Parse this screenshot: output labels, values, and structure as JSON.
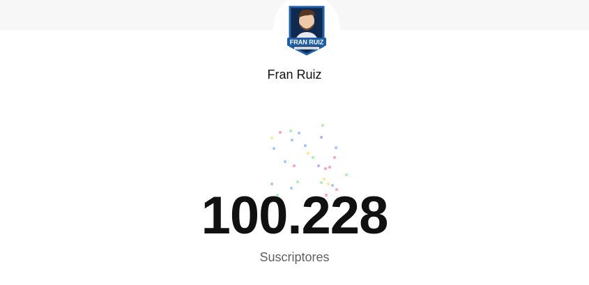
{
  "channel": {
    "name": "Fran Ruiz",
    "logo_text": "FRAN RUIZ"
  },
  "stats": {
    "subscriber_count": "100.228",
    "subscriber_label": "Suscriptores"
  },
  "colors": {
    "top_band": "#f7f7f7",
    "text_primary": "#111111",
    "text_secondary": "#606060",
    "badge_blue": "#1f5fa8",
    "badge_dark": "#0f2a4d"
  },
  "confetti_colors": [
    "#ff9fc4",
    "#9ec8ff",
    "#a6f2b1",
    "#ffe98a",
    "#c6a8ff"
  ]
}
